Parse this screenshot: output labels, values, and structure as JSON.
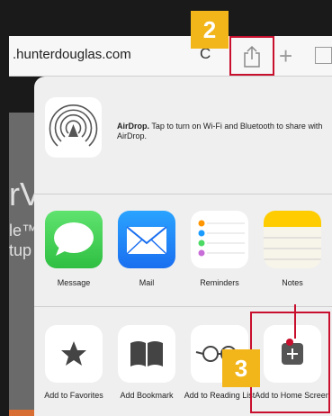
{
  "browser": {
    "url": ".hunterdouglas.com",
    "reload_glyph": "C",
    "new_tab_glyph": "+"
  },
  "background_page": {
    "text_top": "rV",
    "text_mid": "le™ tup"
  },
  "airdrop": {
    "title": "AirDrop.",
    "description": "Tap to turn on Wi-Fi and Bluetooth to share with AirDrop."
  },
  "apps": [
    {
      "label": "Message",
      "icon": "message-icon"
    },
    {
      "label": "Mail",
      "icon": "mail-icon"
    },
    {
      "label": "Reminders",
      "icon": "reminders-icon"
    },
    {
      "label": "Notes",
      "icon": "notes-icon"
    }
  ],
  "actions": [
    {
      "label": "Add to Favorites",
      "icon": "star-icon"
    },
    {
      "label": "Add Bookmark",
      "icon": "book-icon"
    },
    {
      "label": "Add to Reading List",
      "icon": "glasses-icon"
    },
    {
      "label": "Add to Home Screen",
      "icon": "add-square-icon"
    }
  ],
  "callouts": {
    "step2": "2",
    "step3": "3"
  },
  "colors": {
    "highlight": "#c8102e",
    "step_badge": "#f2b61b"
  }
}
